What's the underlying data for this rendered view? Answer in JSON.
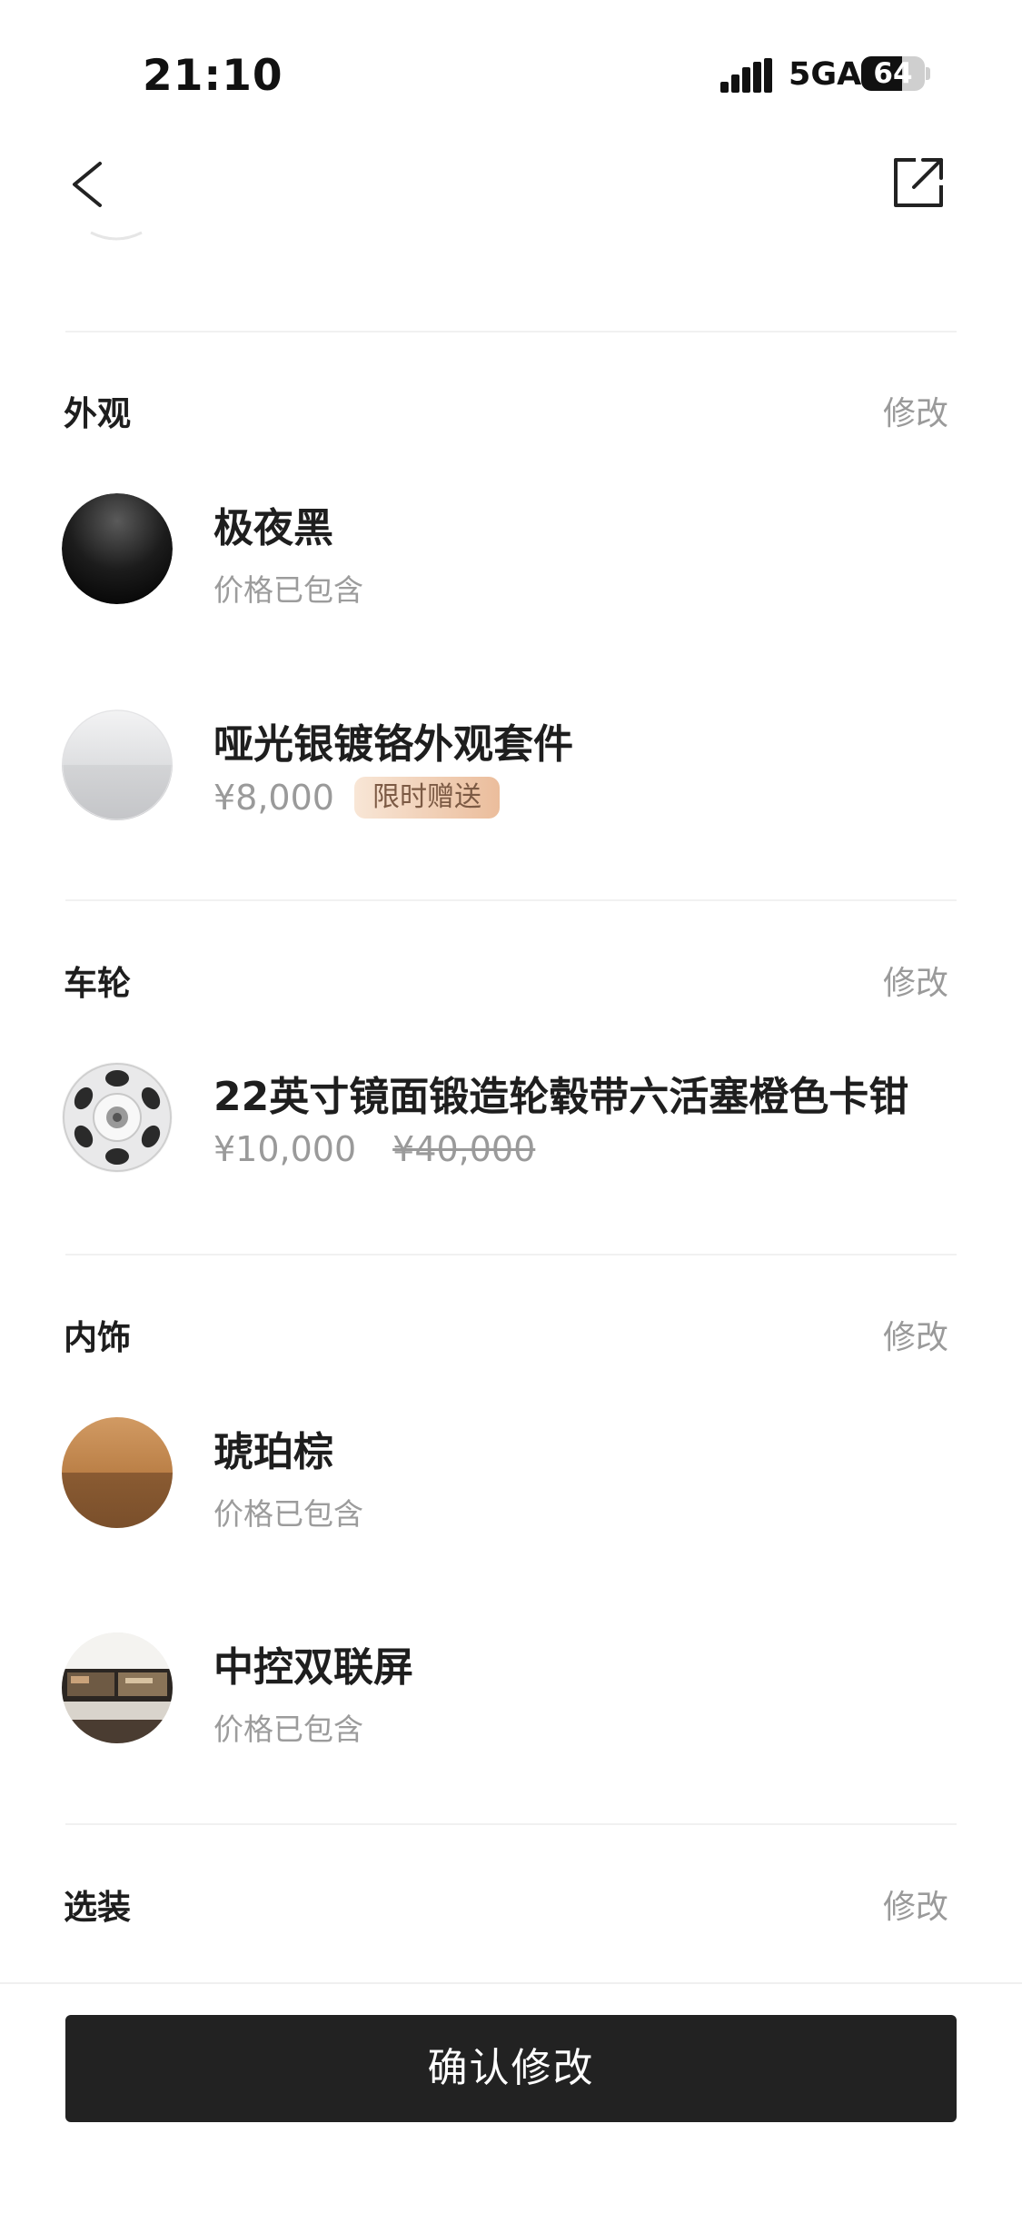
{
  "status_bar": {
    "time": "21:10",
    "network": "5GA",
    "battery": "64",
    "battery_level": 0.64
  },
  "nav": {
    "back_icon": "chevron-left-icon",
    "share_icon": "share-icon"
  },
  "sections": [
    {
      "title": "外观",
      "edit": "修改",
      "items": [
        {
          "name": "极夜黑",
          "sub": "价格已包含",
          "swatch": "black"
        },
        {
          "name": "哑光银镀铬外观套件",
          "price": "¥8,000",
          "tag": "限时赠送",
          "swatch": "silver"
        }
      ]
    },
    {
      "title": "车轮",
      "edit": "修改",
      "items": [
        {
          "name": "22英寸镜面锻造轮毂带六活塞橙色卡钳",
          "price": "¥10,000",
          "original_price": "¥40,000",
          "swatch": "wheel"
        }
      ]
    },
    {
      "title": "内饰",
      "edit": "修改",
      "items": [
        {
          "name": "琥珀棕",
          "sub": "价格已包含",
          "swatch": "amber"
        },
        {
          "name": "中控双联屏",
          "sub": "价格已包含",
          "swatch": "screen"
        }
      ]
    },
    {
      "title": "选装",
      "edit": "修改"
    }
  ],
  "confirm_button": "确认修改",
  "colors": {
    "button_bg": "#222222",
    "tag_gradient_start": "#f8e6d6",
    "tag_gradient_end": "#ebbd9c",
    "muted_text": "#9a9a9a"
  }
}
